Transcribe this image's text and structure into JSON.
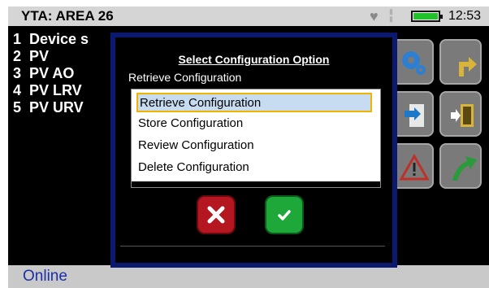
{
  "header": {
    "title": "YTA: AREA 26",
    "time": "12:53",
    "heart_icon": "heart-icon",
    "signal_icon": "signal-icon",
    "battery_icon": "battery-icon"
  },
  "menu": {
    "items": [
      {
        "num": "1",
        "label": "Device s"
      },
      {
        "num": "2",
        "label": "PV"
      },
      {
        "num": "3",
        "label": "PV AO"
      },
      {
        "num": "4",
        "label": "PV LRV"
      },
      {
        "num": "5",
        "label": "PV URV"
      }
    ]
  },
  "tiles": [
    "gear-icon",
    "turn-arrow-icon",
    "export-icon",
    "exit-door-icon",
    "warning-icon",
    "arrow-up-right-icon"
  ],
  "dialog": {
    "title": "Select Configuration Option",
    "current": "Retrieve Configuration",
    "options": [
      "Retrieve Configuration",
      "Store Configuration",
      "Review Configuration",
      "Delete Configuration"
    ],
    "selected_index": 0,
    "cancel_icon": "close-icon",
    "ok_icon": "checkmark-icon"
  },
  "status": {
    "text": "Online"
  },
  "colors": {
    "dialog_border": "#0b1a6e",
    "selection_border": "#f0b400",
    "selection_fill": "#c7dcf0",
    "cancel": "#b4171f",
    "ok": "#1fa83a",
    "status_text": "#1b2fa8"
  }
}
